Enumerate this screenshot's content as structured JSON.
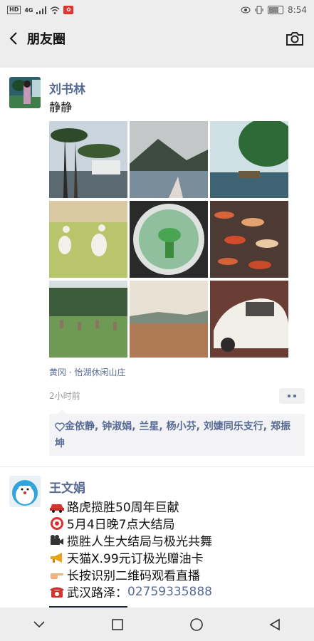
{
  "status_bar": {
    "left_icons": [
      "hd-icon",
      "signal-icon",
      "wifi-icon",
      "huawei-icon"
    ],
    "time": "8:54",
    "battery_level": 0.7,
    "hd": "HD",
    "net": "4G"
  },
  "header": {
    "title": "朋友圈",
    "back_icon": "back-icon",
    "camera_icon": "camera-icon"
  },
  "post1": {
    "author": "刘书林",
    "text": "静静",
    "photos": 9,
    "location": "黄冈 · 怡湖休闲山庄",
    "time": "2小时前",
    "likes": "金依静, 钟淑娟, 兰星, 杨小芬, 刘婕同乐支行, 郑振坤"
  },
  "post2": {
    "author": "王文娟",
    "lines": [
      {
        "icon": "car-emoji",
        "text": "路虎揽胜50周年巨献"
      },
      {
        "icon": "target-emoji",
        "text": "5月4日晚7点大结局"
      },
      {
        "icon": "camera-emoji",
        "text": "揽胜人生大结局与极光共舞"
      },
      {
        "icon": "megaphone-emoji",
        "text": "天猫X.99元订极光赠油卡"
      },
      {
        "icon": "pointing-hand-emoji",
        "text": "长按识别二维码观看直播"
      },
      {
        "icon": "telephone-emoji",
        "text": "武汉路泽：",
        "phone": "02759335888"
      }
    ]
  },
  "navbar": {
    "icons": [
      "nav-back-icon",
      "nav-home-icon",
      "nav-recents-icon"
    ]
  },
  "colors": {
    "link": "#576b95",
    "bg": "#ededed"
  }
}
